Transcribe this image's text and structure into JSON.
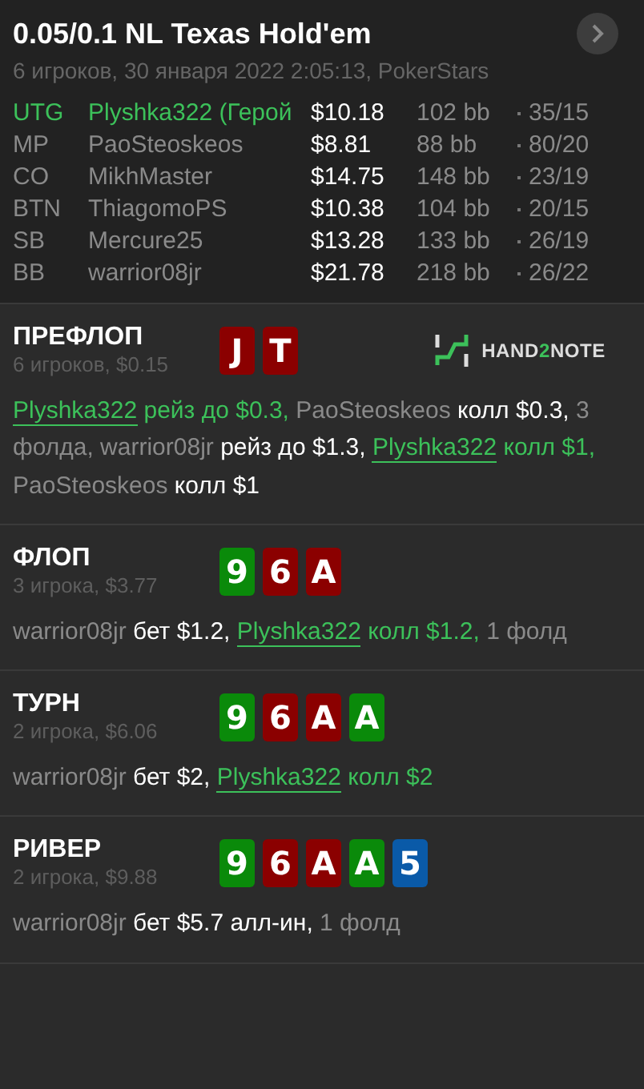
{
  "header": {
    "title": "0.05/0.1 NL Texas Hold'em",
    "subtitle": "6 игроков, 30 января 2022 2:05:13, PokerStars"
  },
  "players": [
    {
      "position": "UTG",
      "name": "Plyshka322",
      "tag": "(Герой",
      "hero": true,
      "stack": "$10.18",
      "bb": "102 bb",
      "stats": "35/15"
    },
    {
      "position": "MP",
      "name": "PaoSteoskeos",
      "hero": false,
      "stack": "$8.81",
      "bb": "88 bb",
      "stats": "80/20"
    },
    {
      "position": "CO",
      "name": "MikhMaster",
      "hero": false,
      "stack": "$14.75",
      "bb": "148 bb",
      "stats": "23/19"
    },
    {
      "position": "BTN",
      "name": "ThiagomoPS",
      "hero": false,
      "stack": "$10.38",
      "bb": "104 bb",
      "stats": "20/15"
    },
    {
      "position": "SB",
      "name": "Mercure25",
      "hero": false,
      "stack": "$13.28",
      "bb": "133 bb",
      "stats": "26/19"
    },
    {
      "position": "BB",
      "name": "warrior08jr",
      "hero": false,
      "stack": "$21.78",
      "bb": "218 bb",
      "stats": "26/22"
    }
  ],
  "streets": [
    {
      "title": "ПРЕФЛОП",
      "subtitle": "6 игроков, $0.15",
      "logo": [
        "HAND",
        "2",
        "NOTE"
      ],
      "cards": [
        {
          "rank": "J",
          "color": "#8b0000"
        },
        {
          "rank": "T",
          "color": "#8b0000"
        }
      ],
      "actions": [
        {
          "kind": "hero",
          "text": "Plyshka322"
        },
        {
          "kind": "hero_action",
          "text": "рейз до $0.3,"
        },
        {
          "kind": "player",
          "text": "PaoSteoskeos"
        },
        {
          "kind": "action",
          "text": "колл $0.3,"
        },
        {
          "kind": "note",
          "text": "3 фолда,"
        },
        {
          "kind": "player",
          "text": "warrior08jr"
        },
        {
          "kind": "action",
          "text": "рейз до $1.3,"
        },
        {
          "kind": "hero",
          "text": "Plyshka322"
        },
        {
          "kind": "hero_action",
          "text": "колл $1,"
        },
        {
          "kind": "player",
          "text": "PaoSteoskeos"
        },
        {
          "kind": "action",
          "text": "колл $1"
        }
      ]
    },
    {
      "title": "ФЛОП",
      "subtitle": "3 игрока, $3.77",
      "cards": [
        {
          "rank": "9",
          "color": "#0a8a0a"
        },
        {
          "rank": "6",
          "color": "#8b0000"
        },
        {
          "rank": "A",
          "color": "#8b0000"
        }
      ],
      "actions": [
        {
          "kind": "player",
          "text": "warrior08jr"
        },
        {
          "kind": "action",
          "text": "бет $1.2,"
        },
        {
          "kind": "hero",
          "text": "Plyshka322"
        },
        {
          "kind": "hero_action",
          "text": "колл $1.2,"
        },
        {
          "kind": "note",
          "text": "1 фолд"
        }
      ]
    },
    {
      "title": "ТУРН",
      "subtitle": "2 игрока, $6.06",
      "cards": [
        {
          "rank": "9",
          "color": "#0a8a0a"
        },
        {
          "rank": "6",
          "color": "#8b0000"
        },
        {
          "rank": "A",
          "color": "#8b0000"
        },
        {
          "rank": "A",
          "color": "#0a8a0a"
        }
      ],
      "actions": [
        {
          "kind": "player",
          "text": "warrior08jr"
        },
        {
          "kind": "action",
          "text": "бет $2,"
        },
        {
          "kind": "hero",
          "text": "Plyshka322"
        },
        {
          "kind": "hero_action",
          "text": "колл $2"
        }
      ]
    },
    {
      "title": "РИВЕР",
      "subtitle": "2 игрока, $9.88",
      "cards": [
        {
          "rank": "9",
          "color": "#0a8a0a"
        },
        {
          "rank": "6",
          "color": "#8b0000"
        },
        {
          "rank": "A",
          "color": "#8b0000"
        },
        {
          "rank": "A",
          "color": "#0a8a0a"
        },
        {
          "rank": "5",
          "color": "#0a5aa8"
        }
      ],
      "actions": [
        {
          "kind": "player",
          "text": "warrior08jr"
        },
        {
          "kind": "action",
          "text": "бет $5.7 алл-ин,"
        },
        {
          "kind": "note",
          "text": "1 фолд"
        }
      ]
    }
  ]
}
